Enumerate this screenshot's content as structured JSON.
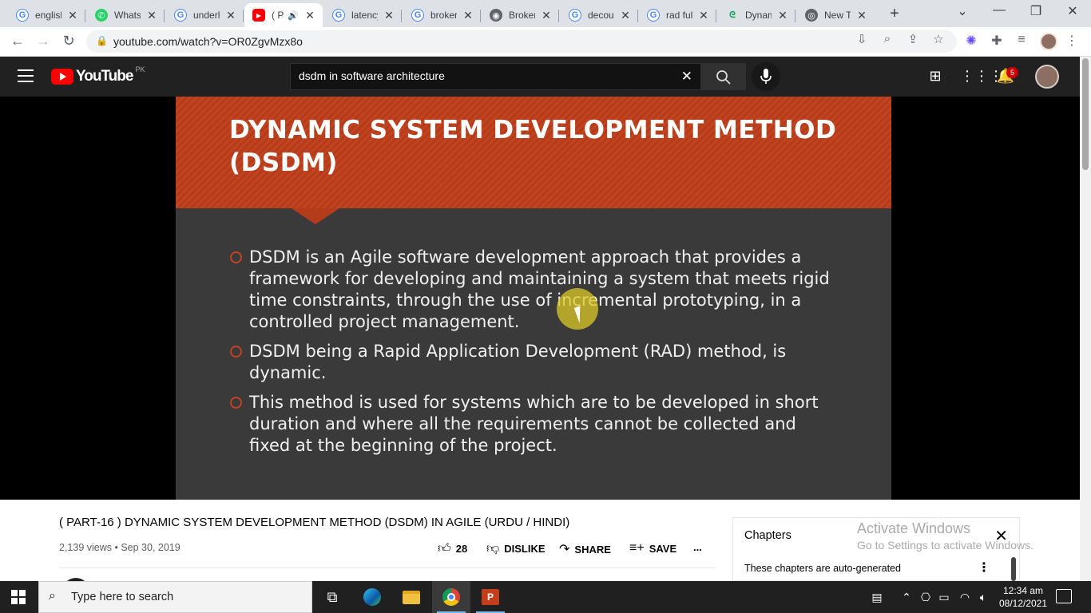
{
  "browser": {
    "tabs": [
      {
        "title": "english",
        "icon": "google-icon",
        "glyph": "G"
      },
      {
        "title": "WhatsApp",
        "icon": "whatsapp-icon",
        "glyph": "✆"
      },
      {
        "title": "underl",
        "icon": "google-icon",
        "glyph": "G"
      },
      {
        "title": "( P",
        "icon": "youtube-icon",
        "glyph": "▶",
        "active": true
      },
      {
        "title": "latency",
        "icon": "google-icon",
        "glyph": "G"
      },
      {
        "title": "broker",
        "icon": "google-icon",
        "glyph": "G"
      },
      {
        "title": "Broker",
        "icon": "globe-icon",
        "glyph": "◉"
      },
      {
        "title": "decou",
        "icon": "google-icon",
        "glyph": "G"
      },
      {
        "title": "rad ful",
        "icon": "google-icon",
        "glyph": "G"
      },
      {
        "title": "Dynam",
        "icon": "geeks-icon",
        "glyph": "ᘓ"
      },
      {
        "title": "New T",
        "icon": "chrome-icon",
        "glyph": "◎"
      }
    ],
    "url": "youtube.com/watch?v=OR0ZgvMzx8o"
  },
  "youtube": {
    "logo_text": "YouTube",
    "country_code": "PK",
    "search_query": "dsdm in software architecture",
    "notification_count": "5"
  },
  "slide": {
    "title_line1": "DYNAMIC SYSTEM DEVELOPMENT METHOD",
    "title_line2": "(DSDM)",
    "bullets": [
      "DSDM is an Agile software development approach that provides a framework for developing and maintaining a system that meets rigid time constraints, through the use of incremental prototyping, in a controlled project management.",
      "DSDM being a Rapid Application Development (RAD) method, is dynamic.",
      "This method is used for systems which are to be developed in short duration and where all the requirements cannot be collected and fixed at the beginning of the project."
    ]
  },
  "video": {
    "title": "( PART-16 ) DYNAMIC SYSTEM DEVELOPMENT METHOD (DSDM) IN AGILE (URDU / HINDI)",
    "views_date": "2,139 views • Sep 30, 2019",
    "like_count": "28",
    "dislike_label": "DISLIKE",
    "share_label": "SHARE",
    "save_label": "SAVE",
    "more_label": "..."
  },
  "chapters": {
    "heading": "Chapters",
    "subtext": "These chapters are auto-generated"
  },
  "watermark": {
    "line1": "Activate Windows",
    "line2": "Go to Settings to activate Windows."
  },
  "taskbar": {
    "search_placeholder": "Type here to search",
    "time": "12:34 am",
    "date": "08/12/2021"
  }
}
